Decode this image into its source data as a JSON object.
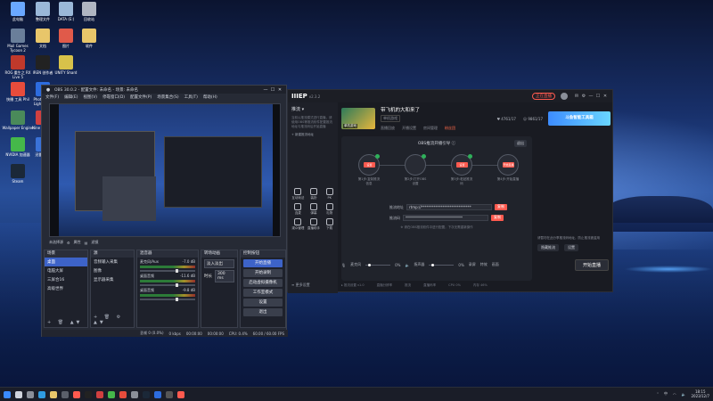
{
  "desktop": {
    "icons": [
      {
        "label": "此电脑",
        "color": "#6aa8ff"
      },
      {
        "label": "整理文件",
        "color": "#9ab8d8"
      },
      {
        "label": "DATA (E:)",
        "color": "#9ab8d8"
      },
      {
        "label": "回收站",
        "color": "#b0b6c2"
      },
      {
        "label": "Mail Games Tycoon 2",
        "color": "#6a7f9a"
      },
      {
        "label": "文档",
        "color": "#e8c66a"
      },
      {
        "label": "图片",
        "color": "#e05a4a"
      },
      {
        "label": "软件",
        "color": "#e8c66a"
      },
      {
        "label": "ROG 重生之 RX Live 5",
        "color": "#c0392b"
      },
      {
        "label": "IREN 创作者",
        "color": "#222222"
      },
      {
        "label": "UNITY Shard",
        "color": "#d8c24a"
      },
      {
        "label": "快播 工具 Phil",
        "color": "#e74c3c"
      },
      {
        "label": "Photoshop Lightroom",
        "color": "#2d6cdf"
      },
      {
        "label": "Wallpaper Engine",
        "color": "#4a8a5a"
      },
      {
        "label": "Nine Worlds",
        "color": "#d04040"
      },
      {
        "label": "NVIDIA 加速器",
        "color": "#45b84a"
      },
      {
        "label": "迅雷 游戏",
        "color": "#3a72d8"
      },
      {
        "label": "Steam",
        "color": "#1b2838"
      }
    ]
  },
  "obs": {
    "title": "OBS 30.0.2 - 配置文件: 未命名 - 场景: 未命名",
    "menu": [
      "文件(F)",
      "编辑(E)",
      "视图(V)",
      "停靠窗口(D)",
      "配置文件(P)",
      "场景集合(S)",
      "工具(T)",
      "帮助(H)"
    ],
    "toolbar": {
      "source_label": "未选择源",
      "properties": "属性",
      "filters": "滤镜"
    },
    "docks": {
      "scenes": {
        "title": "场景",
        "items": [
          "桌面",
          "电脑大屏",
          "三屏合16",
          "高级世界"
        ],
        "selected": 0
      },
      "sources": {
        "title": "源",
        "items": [
          "音频输入采集",
          "图像",
          "显示器采集"
        ]
      },
      "mixer": {
        "title": "混音器",
        "tracks": [
          {
            "name": "麦克风/Aux",
            "db": "-7.0 dB"
          },
          {
            "name": "桌面音频",
            "db": "-11.6 dB"
          },
          {
            "name": "桌面音频",
            "db": "-9.8 dB"
          }
        ]
      },
      "transitions": {
        "title": "转场动画",
        "select": "淡入淡出",
        "duration_label": "时长",
        "duration": "300 ms"
      },
      "controls": {
        "title": "控制按钮",
        "buttons": [
          "开始直播",
          "开始录制",
          "启动虚拟摄像机",
          "工作室模式",
          "设置",
          "退出"
        ]
      }
    },
    "status": {
      "frames": "丢帧 0 (0.0%)",
      "rate": "0 kbps",
      "time1": "00:00:00",
      "time2": "00:00:00",
      "cpu": "CPU: 0.4%",
      "fps": "60.00 / 60.00 FPS"
    }
  },
  "live": {
    "logo": "IIIEP",
    "version": "v2.3.2",
    "rec_badge": "正在直播",
    "side": {
      "header": "推流 ▾",
      "note": "当前以推流模式进行直播，请使用OBS等推流软件配置推流地址与推流码后开始直播",
      "link": "+ 新建推流地址",
      "cells": [
        "互动玩法",
        "装扮",
        "PK",
        "连麦",
        "弹幕",
        "礼物",
        "观众管理",
        "直播助手",
        "下载"
      ],
      "bottom": "≡ 更多设置"
    },
    "room": {
      "name": "带飞机的大和来了",
      "category": "单机游戏",
      "cover_tag": "单机游戏",
      "links": [
        "直播回放",
        "开播设置",
        "房间管理"
      ],
      "hot": "粉丝团"
    },
    "stats": [
      "♥ 4761/17",
      "☺ 9861/17"
    ],
    "ad": "斗鱼智能工具箱",
    "guide": {
      "title": "OBS推流开播引导 ⓘ",
      "btn": "退出",
      "steps": [
        {
          "chip": "设置",
          "caption": "第1步:复制推流信息"
        },
        {
          "chip": "",
          "caption": "第2步:打开OBS设置"
        },
        {
          "chip": "设置",
          "caption": "第3步:粘贴推流码"
        },
        {
          "chip": "开始直播",
          "caption": "第4步:开始直播"
        }
      ],
      "addr_label": "推流地址",
      "addr_value": "rtmp://****************************",
      "key_label": "推流码",
      "key_value": "********************************",
      "copy": "复制",
      "note": "※ 请在OBS推流软件中进行配置，下次无需重新操作"
    },
    "rightpanel": {
      "text": "请暂勿在此分享推流码地址，防止推流被盗用",
      "btns": [
        "隐藏推流",
        "设置"
      ]
    },
    "bottom": {
      "mic": "麦克风",
      "mic_val": "0%",
      "speaker": "扬声器",
      "speaker_val": "0%",
      "items": [
        "录屏",
        "特效",
        "画面"
      ],
      "start": "开始直播"
    },
    "footer": [
      "▸ 推流设置 v1.0",
      "直播分辨率",
      "推流",
      "直播码率",
      "CPU 0%",
      "内存 46%"
    ]
  },
  "taskbar": {
    "time": "18:15",
    "date": "2023/12/7",
    "lang": "中"
  }
}
